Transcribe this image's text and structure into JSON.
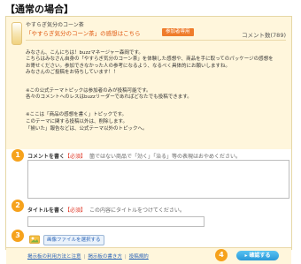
{
  "heading": "【通常の場合】",
  "product": {
    "brand": "やすらぎ気分のコーン茶",
    "subject": "「やすらぎ気分のコーン茶」の感想はこちら",
    "badge": "参加者専用",
    "count": "コメント数(789)"
  },
  "message": {
    "p1": "みなさん、こんにちは！buzzマネージャー森岡です。\nこちらはみなさん自身の「やすらぎ気分のコーン茶」を体験した感想や、商品を手に取ってのパッケージの感想を\nお寄せください。参加できなかった人の参考になるよう、なるべく具体的にお願いしますね。\nみなさんのご投稿をお待ちしています！！",
    "p2": "※この公式テーマトピックは参加者のみが投稿可能です。\n各々のコメントへのレスはbuzzリーダーであればどなたでも投稿できます。",
    "p3": "※ここは「商品の感想を書く」トピックです。\nこのテーマに関する投稿以外は、削除します。\n「揃いた」報告などは、公式テーマ以外のトピックへ。"
  },
  "form": {
    "step1": "1",
    "comment_label": "コメントを書く",
    "required": "【必須】",
    "comment_hint": "箇ではない商品で「効く」「治る」等の表現はおやめください。",
    "step2": "2",
    "title_label": "タイトルを書く",
    "title_hint": "この内容にタイトルをつけてください。",
    "step3": "3",
    "file_button": "画像ファイルを選択する",
    "step4": "4",
    "confirm_button": "▸ 確認する"
  },
  "footer": {
    "link1": "掲示板の利用方法と注意",
    "link2": "掲示板の書き方",
    "link3": "投稿規約"
  },
  "colors": {
    "accent": "#f6a21c",
    "link": "#2a64b8",
    "required": "#e03a2a",
    "button": "#2a98d8"
  }
}
